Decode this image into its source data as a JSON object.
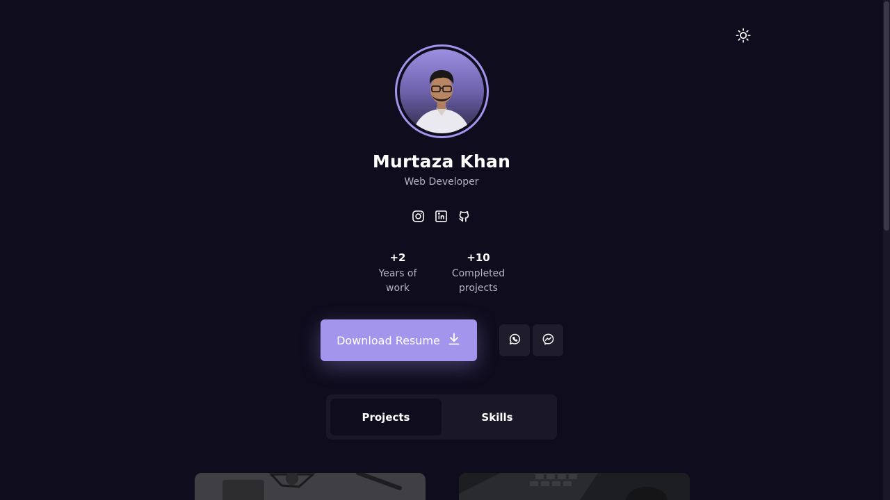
{
  "profile": {
    "name": "Murtaza Khan",
    "role": "Web Developer"
  },
  "socials": [
    {
      "icon": "instagram-icon"
    },
    {
      "icon": "linkedin-icon"
    },
    {
      "icon": "github-icon"
    }
  ],
  "stats": [
    {
      "value": "+2",
      "label_line1": "Years of",
      "label_line2": "work"
    },
    {
      "value": "+10",
      "label_line1": "Completed",
      "label_line2": "projects"
    }
  ],
  "actions": {
    "download_label": "Download Resume",
    "whatsapp_icon": "whatsapp-icon",
    "messenger_icon": "messenger-icon"
  },
  "tabs": [
    {
      "label": "Projects",
      "active": true
    },
    {
      "label": "Skills",
      "active": false
    }
  ],
  "colors": {
    "background": "#0f0c1d",
    "accent": "#a394ec",
    "muted_text": "#b6b3c2",
    "panel": "#1a1727"
  }
}
